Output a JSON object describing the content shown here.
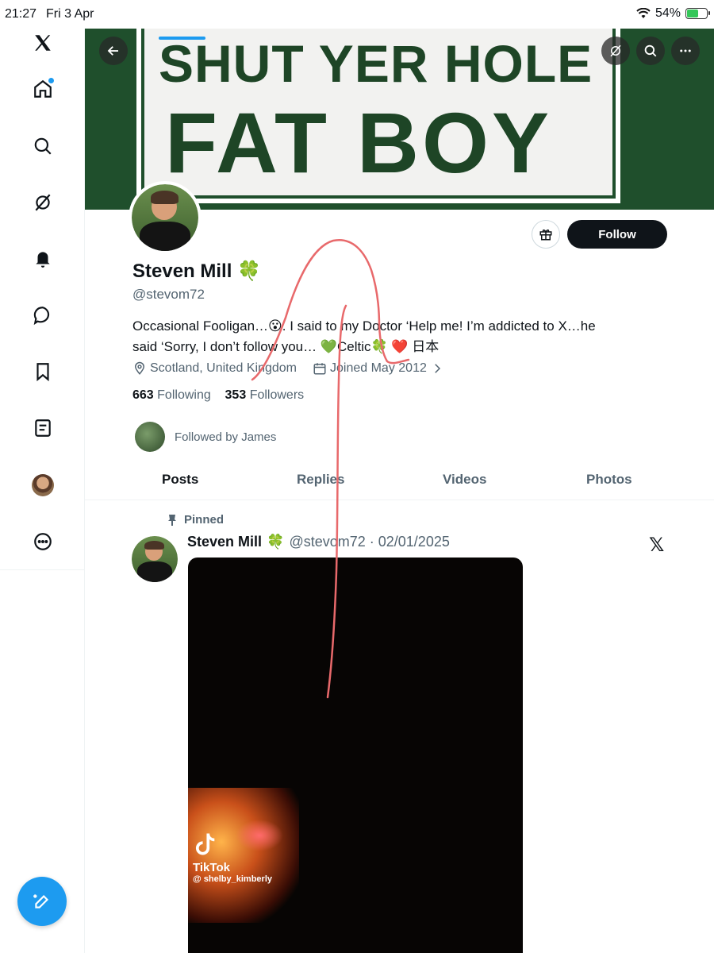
{
  "status_bar": {
    "time": "21:27",
    "date": "Fri 3 Apr",
    "battery": "54%",
    "battery_level": 0.54
  },
  "banner": {
    "line1": "SHUT YER HOLE",
    "line2": "FAT BOY"
  },
  "profile": {
    "name": "Steven Mill",
    "name_emoji": "🍀",
    "handle": "@stevom72",
    "bio_line1": "Occasional Fooligan…😮. I said to my Doctor ‘Help me! I’m addicted to X…he",
    "bio_line2": "said ‘Sorry, I don’t follow you… 💚Celtic🍀 ❤️ 日本",
    "location": "Scotland, United Kingdom",
    "joined": "Joined May 2012",
    "following_count": "663",
    "following_label": "Following",
    "followers_count": "353",
    "followers_label": "Followers",
    "followed_by": "Followed by James",
    "follow_label": "Follow"
  },
  "tabs": [
    {
      "label": "Posts",
      "active": true
    },
    {
      "label": "Replies"
    },
    {
      "label": "Videos"
    },
    {
      "label": "Photos"
    }
  ],
  "post": {
    "pinned_label": "Pinned",
    "author": "Steven Mill",
    "author_emoji": "🍀",
    "handle_date": "@stevom72 · 02/01/2025",
    "x_mark": "𝕏",
    "tiktok_label": "TikTok",
    "tiktok_user": "@ shelby_kimberly"
  },
  "sidebar": {
    "items": [
      "x-logo-icon",
      "home-icon",
      "search-icon",
      "grok-icon",
      "notifications-icon",
      "messages-icon",
      "bookmarks-icon",
      "lists-icon",
      "profile-avatar",
      "more-icon"
    ]
  },
  "colors": {
    "accent": "#1d9bf0",
    "annotation": "#e8696b",
    "banner_green": "#1f4f2c"
  }
}
